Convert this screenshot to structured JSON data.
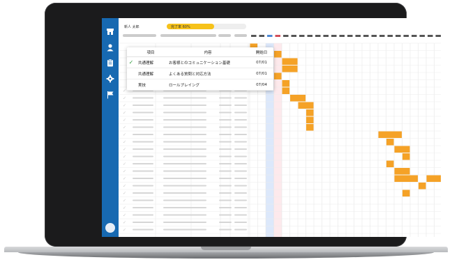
{
  "header": {
    "user_name": "新人 太郎",
    "progress_label": "完了率 60%",
    "progress": 0.6
  },
  "popup": {
    "columns": [
      "項目",
      "内容",
      "開始日"
    ],
    "rows": [
      {
        "checked": true,
        "category": "共通理解",
        "content": "お客様とのコミュニケーション基礎",
        "date": "07/01"
      },
      {
        "checked": false,
        "category": "共通理解",
        "content": "よくある質問と対応方法",
        "date": "07/01"
      },
      {
        "checked": false,
        "category": "実技",
        "content": "ロールプレイング",
        "date": "07/04"
      }
    ]
  },
  "sidebar": {
    "items": [
      {
        "icon": "store-icon"
      },
      {
        "icon": "user-icon"
      },
      {
        "icon": "clipboard-icon"
      },
      {
        "icon": "gear-icon"
      },
      {
        "icon": "flag-icon"
      }
    ]
  },
  "colors": {
    "sidebar": "#1769b1",
    "bar": "#f5a227",
    "highlight_blue": "#dce8fb",
    "highlight_pink": "#fde9ec",
    "progress": "#f6c21a",
    "check": "#2e9c3e"
  }
}
